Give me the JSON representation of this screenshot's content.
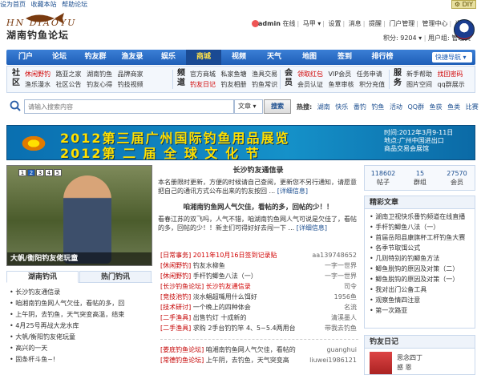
{
  "topbar": {
    "links": [
      "设为首页",
      "收藏本站",
      "帮助论坛"
    ],
    "diy": "DIY"
  },
  "logo": {
    "line1": "HN DIAOYU",
    "line2": "湖南钓鱼论坛"
  },
  "user": {
    "name": "admin",
    "status": "在线",
    "items": [
      "马甲",
      "设置",
      "消息",
      "提醒",
      "门户管理",
      "管理中心",
      "退出"
    ],
    "points": "积分: 9204",
    "group": "用户组: 管理员"
  },
  "mainnav": {
    "items": [
      "门户",
      "论坛",
      "钓友群",
      "渔友录",
      "娱乐",
      "商城",
      "视频",
      "天气",
      "地图",
      "签到",
      "排行榜"
    ],
    "active_index": 5,
    "quick": "快捷导航"
  },
  "subnav": {
    "groups": [
      {
        "title": "社区",
        "rows": [
          [
            "休闲野钓",
            "路亚之家",
            "湖南钓鱼",
            "品牌商家"
          ],
          [
            "渔乐漫水",
            "社区公告",
            "钓友心得",
            "钓技视频"
          ]
        ]
      },
      {
        "title": "频道",
        "rows": [
          [
            "官方商城",
            "私家鱼塘",
            "渔具交易"
          ],
          [
            "钓友日记",
            "钓友相册",
            "钓鱼常识"
          ]
        ]
      },
      {
        "title": "会员",
        "rows": [
          [
            "领取红包",
            "VIP会员",
            "任务申请"
          ],
          [
            "会员认证",
            "鱼草审核",
            "积分充值"
          ]
        ]
      },
      {
        "title": "服务",
        "rows": [
          [
            "新手帮助",
            "找回密码"
          ],
          [
            "图片空间",
            "qq群展示"
          ]
        ]
      }
    ]
  },
  "search": {
    "placeholder": "请输入搜索内容",
    "type": "文章",
    "button": "搜索",
    "hot_label": "热搜:",
    "hot": [
      "湖南",
      "快乐",
      "番钓",
      "钓鱼",
      "活动",
      "QQ群",
      "鱼获",
      "鱼类",
      "比赛"
    ]
  },
  "banner": {
    "line1": "2012第三届广州国际钓鱼用品展览",
    "line2": "2012第 二 届 全 球 文 化 节",
    "info1": "时间:2012年3月9-11日",
    "info2": "地点:广州中国进出口",
    "info3": "商品交易会展馆"
  },
  "slideshow": {
    "caption": "大帆/衡阳钓友佬玩童",
    "nums": [
      "1",
      "2",
      "3",
      "4",
      "5"
    ],
    "active": 1
  },
  "lefttabs": {
    "tabs": [
      "湖南钓讯",
      "热门钓讯"
    ],
    "active": 0
  },
  "leftlist": [
    "长沙钓友通信录",
    "咱湘南钓鱼网人气欠佳，看帖的多，回",
    "上午阴，去钓鱼，天气突变高温，结束",
    "4月25号再战大龙水库",
    "大帆/衡阳钓友佬玩童",
    "高兴的一天",
    "固条杆斗鱼~!"
  ],
  "notice": {
    "title": "长沙钓友通信录",
    "text": "本名册限时更新，方便的时候请自己查阅，更新您不另行通知，请愿意把自己的通讯方式公布出来的钓友按回 ...",
    "more": "[详细信息]",
    "sub": "咱湘南钓鱼网人气欠佳，看帖的多，回帖的少！！",
    "text2": "看春江苏的双飞吗，人气不错，咱湖南钓鱼网人气可说是欠佳了，看帖的多，回帖的少！！新主们可得好好去闯一下 ...",
    "more2": "[详细信息]"
  },
  "newslist": [
    {
      "cat": "[日常事务]",
      "title": "2011年10月16日签到记录贴",
      "author": "aa139748652",
      "red": true
    },
    {
      "cat": "[休闲野钓]",
      "title": "钓友水柳鱼",
      "author": "一字一世界",
      "red": false
    },
    {
      "cat": "[休闲野钓]",
      "title": "手杆钓鲫鱼八法（一）",
      "author": "一字一世界",
      "red": false
    },
    {
      "cat": "[长沙钓鱼论坛]",
      "title": "长沙钓友通信录",
      "author": "司令",
      "red": true
    },
    {
      "cat": "[竞技池钓]",
      "title": "淡水鲳超嘴用什么饵好",
      "author": "1956鱼",
      "red": false
    },
    {
      "cat": "[技术研讨]",
      "title": "一个晚上的四种体会",
      "author": "名流",
      "red": false
    },
    {
      "cat": "[二手渔具]",
      "title": "出售钓灯 十成新的",
      "author": "清溪墨人",
      "red": false
    },
    {
      "cat": "[二手渔具]",
      "title": "求购 2手台钓钓竿 4、5~5.4两用台",
      "author": "带我去钓鱼",
      "red": false
    },
    {
      "cat": "[娄底钓鱼论坛]",
      "title": "咱湘南钓鱼网人气欠佳，看帖的",
      "author": "guanghui",
      "red": false
    },
    {
      "cat": "[常德钓鱼论坛]",
      "title": "上午阴，去钓鱼，天气突变高",
      "author": "liuwei1986121",
      "red": false
    }
  ],
  "stats": [
    {
      "n": "118602",
      "l": "帖子"
    },
    {
      "n": "15",
      "l": "群组"
    },
    {
      "n": "27570",
      "l": "会员"
    }
  ],
  "rec": {
    "title": "精彩文章",
    "items": [
      "湖南卫视快乐番钓频道在线直播",
      "手杆钓鲫鱼八法（一）",
      "首届岳阳县康旗杯工杆钓鱼大赛",
      "各季节取饵公式",
      "几则特别的钓鲫鱼方法",
      "鲫鱼脱钩的原因及对策（二）",
      "鲫鱼脱钩的原因及对策（一）",
      "我对出门公备工具",
      "观察鱼情四注意",
      "第一次路亚"
    ]
  },
  "diary": {
    "title": "钓友日记",
    "name1": "思念四丁",
    "name2": "感 恩"
  }
}
